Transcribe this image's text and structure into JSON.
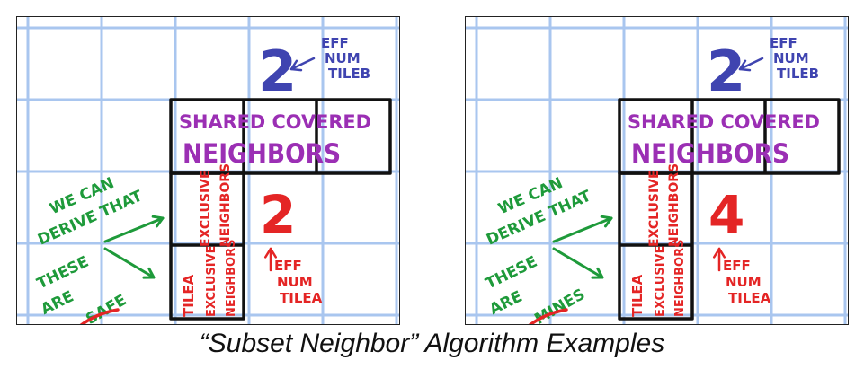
{
  "caption": "“Subset Neighbor” Algorithm Examples",
  "colors": {
    "grid": "#a9c6ef",
    "blue": "#3f44b0",
    "purple": "#9b2fb4",
    "green": "#1e9a3a",
    "red": "#e42525",
    "black": "#111111"
  },
  "panels": [
    {
      "tile_b_number": "2",
      "tile_b_label": [
        "EFF",
        "NUM",
        "TILEB"
      ],
      "shared_label": [
        "SHARED COVERED",
        "NEIGHBORS"
      ],
      "exclusive_label": [
        "EXCLUSIVE",
        "NEIGHBORS"
      ],
      "tile_a_cell": "TILEA",
      "tile_a_number": "2",
      "tile_a_label": [
        "EFF",
        "NUM",
        "TILEA"
      ],
      "derive_text": [
        "WE CAN",
        "DERIVE THAT",
        "THESE",
        "ARE"
      ],
      "result_word": "SAFE"
    },
    {
      "tile_b_number": "2",
      "tile_b_label": [
        "EFF",
        "NUM",
        "TILEB"
      ],
      "shared_label": [
        "SHARED COVERED",
        "NEIGHBORS"
      ],
      "exclusive_label": [
        "EXCLUSIVE",
        "NEIGHBORS"
      ],
      "tile_a_cell": "TILEA",
      "tile_a_number": "4",
      "tile_a_label": [
        "EFF",
        "NUM",
        "TILEA"
      ],
      "derive_text": [
        "WE CAN",
        "DERIVE THAT",
        "THESE",
        "ARE"
      ],
      "result_word": "MINES"
    }
  ]
}
